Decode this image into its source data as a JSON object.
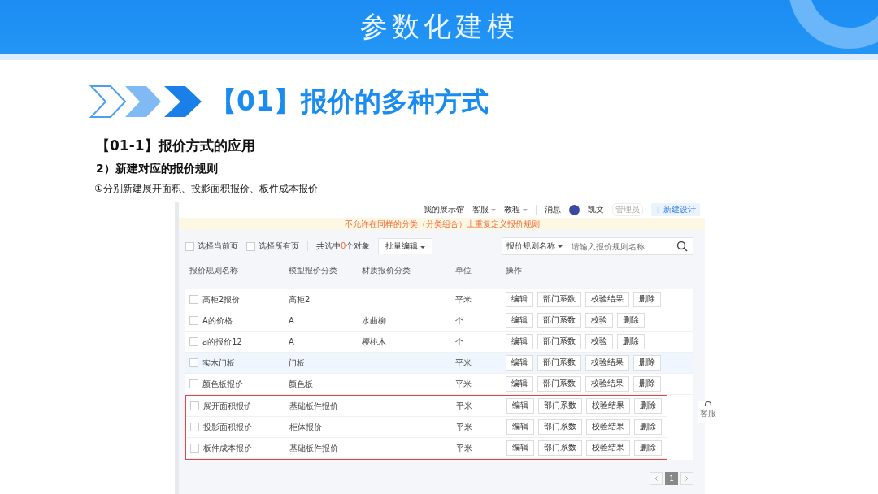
{
  "slide": {
    "title": "参数化建模",
    "heading": "【01】报价的多种方式",
    "section": "【01-1】报价方式的应用",
    "subsection": "2）新建对应的报价规则",
    "note": "①分别新建展开面积、投影面积报价、板件成本报价"
  },
  "app": {
    "nav": [
      {
        "label": "我的展示馆",
        "dropdown": false
      },
      {
        "label": "客服",
        "dropdown": true
      },
      {
        "label": "教程",
        "dropdown": true
      }
    ],
    "messages": "消息",
    "user": {
      "name": "凯文",
      "role": "管理员"
    },
    "new_button": "新建设计",
    "notice": "不允许在同样的分类（分类组合）上重复定义报价规则",
    "select_options": [
      {
        "label": "选择当前页",
        "checked": false
      },
      {
        "label": "选择所有页",
        "checked": false
      }
    ],
    "selection": {
      "prefix": "共选中",
      "count": "0",
      "suffix": "个对象"
    },
    "batch_button": "批量编辑",
    "search": {
      "field": "报价规则名称",
      "placeholder": "请输入报价规则名称"
    },
    "table": {
      "columns": [
        "报价规则名称",
        "模型报价分类",
        "材质报价分类",
        "单位",
        "操作"
      ],
      "rows": [
        {
          "name": "高柜2报价",
          "model": "高柜2",
          "material": "",
          "unit": "平米",
          "checked": false,
          "highlighted": false,
          "actions": [
            "编辑",
            "部门系数",
            "校验结果",
            "删除"
          ]
        },
        {
          "name": "A的价格",
          "model": "A",
          "material": "水曲柳",
          "unit": "个",
          "checked": false,
          "highlighted": false,
          "actions": [
            "编辑",
            "部门系数",
            "校验",
            "删除"
          ]
        },
        {
          "name": "a的报价12",
          "model": "A",
          "material": "樱桃木",
          "unit": "个",
          "checked": false,
          "highlighted": false,
          "actions": [
            "编辑",
            "部门系数",
            "校验",
            "删除"
          ]
        },
        {
          "name": "实木门板",
          "model": "门板",
          "material": "",
          "unit": "平米",
          "checked": false,
          "highlighted": true,
          "actions": [
            "编辑",
            "部门系数",
            "校验结果",
            "删除"
          ]
        },
        {
          "name": "颜色板报价",
          "model": "颜色板",
          "material": "",
          "unit": "平米",
          "checked": false,
          "highlighted": false,
          "actions": [
            "编辑",
            "部门系数",
            "校验结果",
            "删除"
          ]
        }
      ],
      "boxed_rows": [
        {
          "name": "展开面积报价",
          "model": "基础板件报价",
          "material": "",
          "unit": "平米",
          "checked": false,
          "highlighted": false,
          "actions": [
            "编辑",
            "部门系数",
            "校验结果",
            "删除"
          ]
        },
        {
          "name": "投影面积报价",
          "model": "柜体报价",
          "material": "",
          "unit": "平米",
          "checked": false,
          "highlighted": false,
          "actions": [
            "编辑",
            "部门系数",
            "校验结果",
            "删除"
          ]
        },
        {
          "name": "板件成本报价",
          "model": "基础板件报价",
          "material": "",
          "unit": "平米",
          "checked": false,
          "highlighted": false,
          "actions": [
            "编辑",
            "部门系数",
            "校验结果",
            "删除"
          ]
        }
      ]
    },
    "service": "客服",
    "pagination": [
      {
        "label": "1",
        "selected": true
      }
    ]
  }
}
